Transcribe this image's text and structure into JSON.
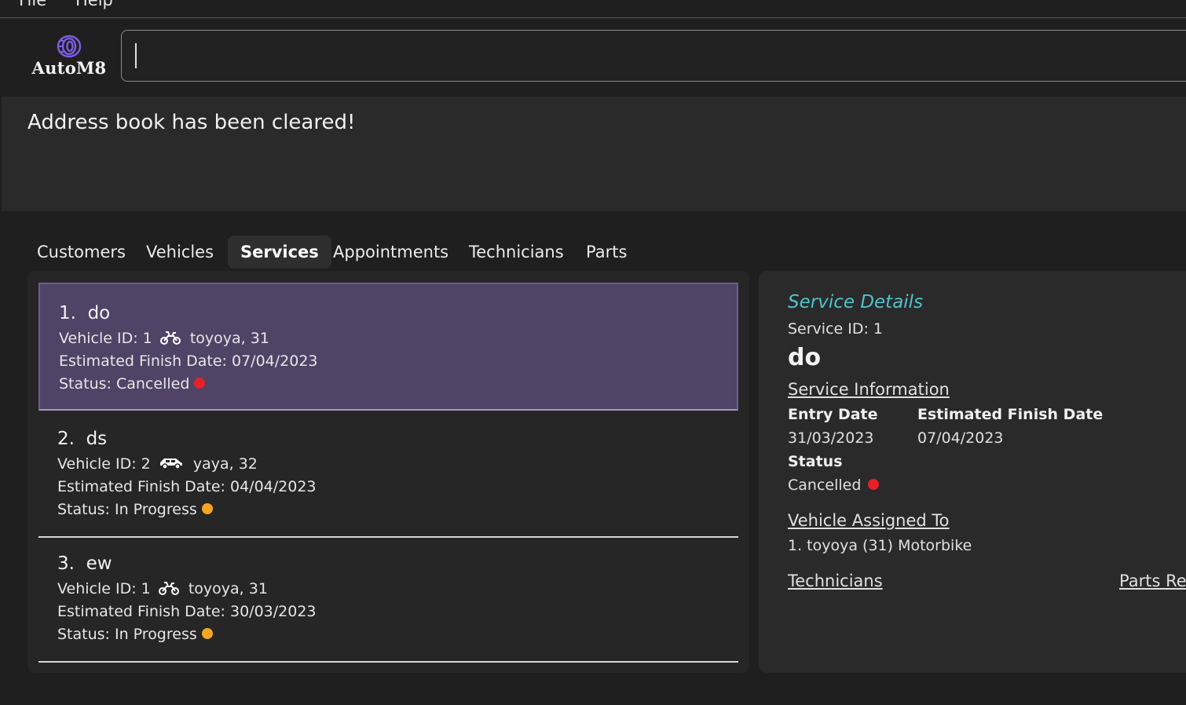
{
  "menu": {
    "file": "File",
    "help": "Help"
  },
  "logo": {
    "text": "AutoM8",
    "icon": "tire-icon"
  },
  "command": {
    "value": "",
    "placeholder": ""
  },
  "result": {
    "text": "Address book has been cleared!"
  },
  "tabs": [
    {
      "label": "Customers",
      "active": false
    },
    {
      "label": "Vehicles",
      "active": false
    },
    {
      "label": "Services",
      "active": true
    },
    {
      "label": "Appointments",
      "active": false
    },
    {
      "label": "Technicians",
      "active": false
    },
    {
      "label": "Parts",
      "active": false
    }
  ],
  "services": [
    {
      "index": "1.",
      "name": "do",
      "vehicle_id_label": "Vehicle ID: 1",
      "vehicle_icon": "motorbike-icon",
      "vehicle_desc": "toyoya, 31",
      "finish_label": "Estimated Finish Date: 07/04/2023",
      "status_label": "Status: Cancelled",
      "status_color": "#e8202a",
      "selected": true
    },
    {
      "index": "2.",
      "name": "ds",
      "vehicle_id_label": "Vehicle ID: 2",
      "vehicle_icon": "car-icon",
      "vehicle_desc": "yaya, 32",
      "finish_label": "Estimated Finish Date: 04/04/2023",
      "status_label": "Status: In Progress",
      "status_color": "#f5a623",
      "selected": false
    },
    {
      "index": "3.",
      "name": "ew",
      "vehicle_id_label": "Vehicle ID: 1",
      "vehicle_icon": "motorbike-icon",
      "vehicle_desc": "toyoya, 31",
      "finish_label": "Estimated Finish Date: 30/03/2023",
      "status_label": "Status: In Progress",
      "status_color": "#f5a623",
      "selected": false
    }
  ],
  "details": {
    "header": "Service Details",
    "service_id": "Service ID: 1",
    "name": "do",
    "info_heading": "Service Information",
    "entry_date_label": "Entry Date",
    "entry_date_value": "31/03/2023",
    "finish_date_label": "Estimated Finish Date",
    "finish_date_value": "07/04/2023",
    "status_label": "Status",
    "status_value": "Cancelled",
    "status_color": "#e8202a",
    "vehicle_heading": "Vehicle Assigned To",
    "vehicle_value": "1. toyoya (31) Motorbike",
    "technicians_heading": "Technicians",
    "parts_heading": "Parts Re"
  },
  "colors": {
    "accent_header": "#4fc3cc",
    "selected_card": "#4f4466",
    "background": "#1f1f1f"
  }
}
